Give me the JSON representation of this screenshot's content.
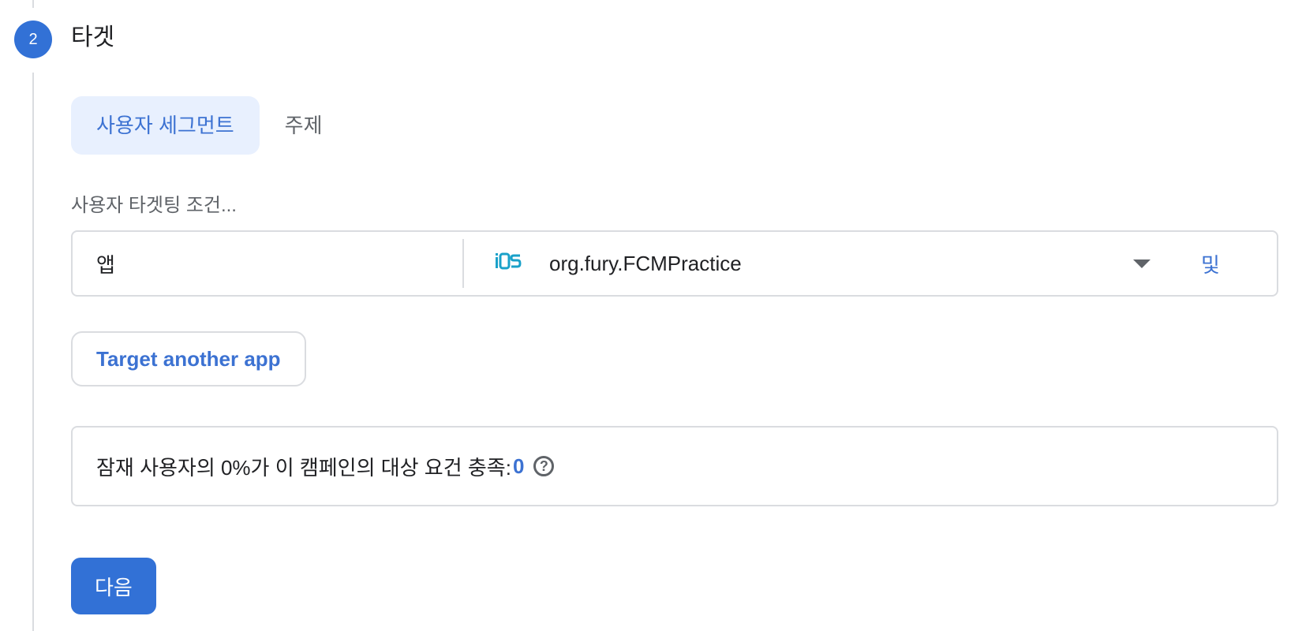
{
  "step": {
    "number": "2",
    "title": "타겟"
  },
  "tabs": [
    {
      "label": "사용자 세그먼트",
      "active": true
    },
    {
      "label": "주제",
      "active": false
    }
  ],
  "targeting": {
    "label": "사용자 타겟팅 조건...",
    "criteria": {
      "field": "앱",
      "platform_badge": "iOS",
      "app_name": "org.fury.FCMPractice",
      "and_label": "및"
    },
    "target_another_app_label": "Target another app"
  },
  "estimate": {
    "text": "잠재 사용자의 0%가 이 캠페인의 대상 요건 충족:",
    "count": "0",
    "help_icon": "help-circle-icon"
  },
  "actions": {
    "next_label": "다음"
  },
  "colors": {
    "accent": "#3271d6",
    "link": "#3c72d2",
    "active_tab_bg": "#e8f0fe",
    "ios_badge": "#1aa1c9",
    "border": "#dadce0"
  }
}
